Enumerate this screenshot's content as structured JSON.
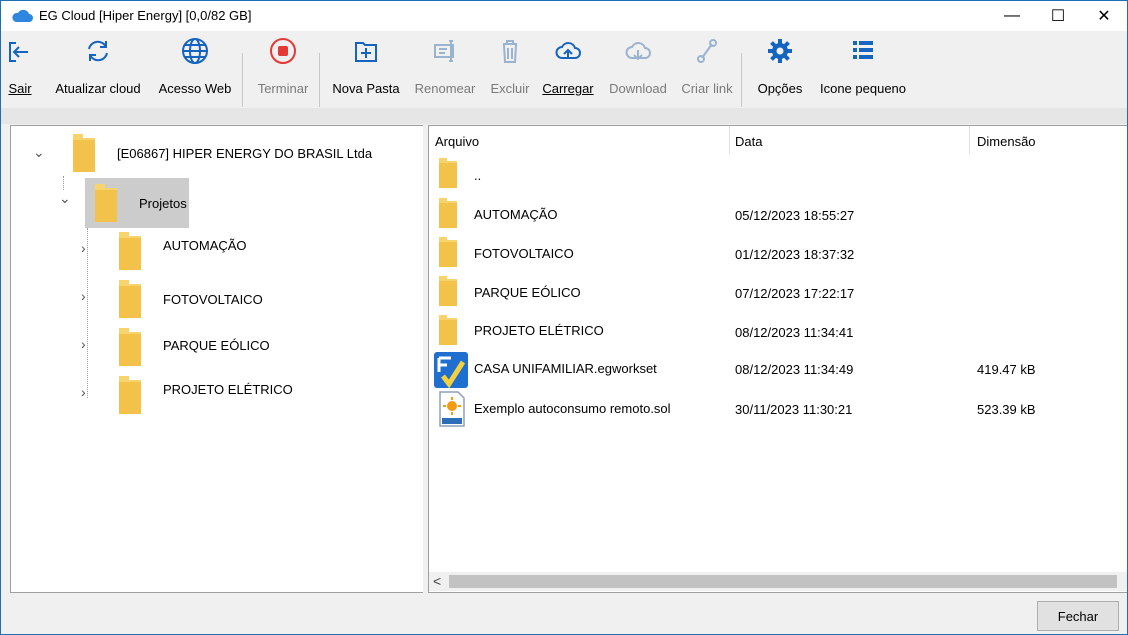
{
  "window": {
    "title": "EG Cloud [Hiper Energy] [0,0/82 GB]",
    "minimize_glyph": "—",
    "maximize_glyph": "☐",
    "close_glyph": "✕"
  },
  "toolbar": {
    "items": [
      {
        "id": "sair",
        "label": "Sair",
        "enabled": true,
        "icon": "exit-icon"
      },
      {
        "id": "atualizar",
        "label": "Atualizar cloud",
        "enabled": true,
        "icon": "refresh-icon"
      },
      {
        "id": "acesso",
        "label": "Acesso Web",
        "enabled": true,
        "icon": "globe-icon"
      },
      {
        "id": "terminar",
        "label": "Terminar",
        "enabled": false,
        "icon": "stop-icon"
      },
      {
        "id": "nova",
        "label": "Nova Pasta",
        "enabled": true,
        "icon": "new-folder-icon"
      },
      {
        "id": "renomear",
        "label": "Renomear",
        "enabled": false,
        "icon": "rename-icon"
      },
      {
        "id": "excluir",
        "label": "Excluir",
        "enabled": false,
        "icon": "trash-icon"
      },
      {
        "id": "carregar",
        "label": "Carregar",
        "enabled": true,
        "icon": "upload-cloud-icon"
      },
      {
        "id": "download",
        "label": "Download",
        "enabled": false,
        "icon": "download-cloud-icon"
      },
      {
        "id": "criar",
        "label": "Criar link",
        "enabled": false,
        "icon": "link-icon"
      },
      {
        "id": "opcoes",
        "label": "Opções",
        "enabled": true,
        "icon": "gear-icon"
      },
      {
        "id": "icone",
        "label": "Icone pequeno",
        "enabled": true,
        "icon": "list-icon"
      }
    ]
  },
  "tree": {
    "root": "[E06867] HIPER ENERGY DO BRASIL Ltda",
    "selected": "Projetos",
    "children": [
      "AUTOMAÇÃO",
      "FOTOVOLTAICO",
      "PARQUE EÓLICO",
      "PROJETO ELÉTRICO"
    ],
    "expanded_glyph": "⌄",
    "collapsed_glyph": "›"
  },
  "list": {
    "columns": [
      "Arquivo",
      "Data",
      "Dimensão"
    ],
    "rows": [
      {
        "name": "..",
        "date": "",
        "size": "",
        "type": "folder"
      },
      {
        "name": "AUTOMAÇÃO",
        "date": "05/12/2023 18:55:27",
        "size": "",
        "type": "folder"
      },
      {
        "name": "FOTOVOLTAICO",
        "date": "01/12/2023 18:37:32",
        "size": "",
        "type": "folder"
      },
      {
        "name": "PARQUE EÓLICO",
        "date": "07/12/2023 17:22:17",
        "size": "",
        "type": "folder"
      },
      {
        "name": "PROJETO ELÉTRICO",
        "date": "08/12/2023 11:34:41",
        "size": "",
        "type": "folder"
      },
      {
        "name": "CASA UNIFAMILIAR.egworkset",
        "date": "08/12/2023 11:34:49",
        "size": "419.47 kB",
        "type": "egworkset"
      },
      {
        "name": "Exemplo autoconsumo remoto.sol",
        "date": "30/11/2023 11:30:21",
        "size": "523.39 kB",
        "type": "sol"
      }
    ],
    "scroll_left_glyph": "<"
  },
  "footer": {
    "close_label": "Fechar"
  },
  "colors": {
    "accent": "#1f6fb5",
    "icon_blue": "#1565c0",
    "icon_red": "#e53935",
    "folder": "#f7d36b",
    "selection": "#cccccc",
    "disabled": "#9ab4cf"
  }
}
